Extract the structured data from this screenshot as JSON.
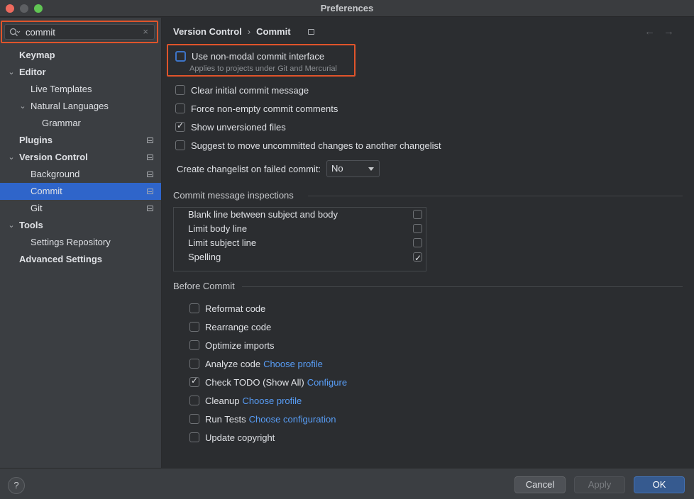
{
  "window": {
    "title": "Preferences"
  },
  "search": {
    "value": "commit",
    "clear_glyph": "×"
  },
  "sidebar": {
    "items": [
      {
        "label": "Keymap"
      },
      {
        "label": "Editor"
      },
      {
        "label": "Live Templates"
      },
      {
        "label": "Natural Languages"
      },
      {
        "label": "Grammar"
      },
      {
        "label": "Plugins"
      },
      {
        "label": "Version Control"
      },
      {
        "label": "Background"
      },
      {
        "label": "Commit"
      },
      {
        "label": "Git"
      },
      {
        "label": "Tools"
      },
      {
        "label": "Settings Repository"
      },
      {
        "label": "Advanced Settings"
      }
    ]
  },
  "breadcrumb": {
    "parent": "Version Control",
    "separator": "›",
    "current": "Commit"
  },
  "nav": {
    "back": "←",
    "forward": "→"
  },
  "options": {
    "non_modal": {
      "label": "Use non-modal commit interface",
      "hint": "Applies to projects under Git and Mercurial",
      "checked": false
    },
    "clear_initial": {
      "label": "Clear initial commit message",
      "checked": false
    },
    "force_nonempty": {
      "label": "Force non-empty commit comments",
      "checked": false
    },
    "show_unversioned": {
      "label": "Show unversioned files",
      "checked": true
    },
    "suggest_move": {
      "label": "Suggest to move uncommitted changes to another changelist",
      "checked": false
    }
  },
  "changelist": {
    "label": "Create changelist on failed commit:",
    "value": "No"
  },
  "inspections": {
    "title": "Commit message inspections",
    "items": [
      {
        "label": "Blank line between subject and body",
        "checked": false
      },
      {
        "label": "Limit body line",
        "checked": false
      },
      {
        "label": "Limit subject line",
        "checked": false
      },
      {
        "label": "Spelling",
        "checked": true
      }
    ]
  },
  "before_commit": {
    "title": "Before Commit",
    "items": [
      {
        "label": "Reformat code",
        "link": "",
        "checked": false
      },
      {
        "label": "Rearrange code",
        "link": "",
        "checked": false
      },
      {
        "label": "Optimize imports",
        "link": "",
        "checked": false
      },
      {
        "label": "Analyze code",
        "link": "Choose profile",
        "checked": false
      },
      {
        "label": "Check TODO (Show All)",
        "link": "Configure",
        "checked": true
      },
      {
        "label": "Cleanup",
        "link": "Choose profile",
        "checked": false
      },
      {
        "label": "Run Tests",
        "link": "Choose configuration",
        "checked": false
      },
      {
        "label": "Update copyright",
        "link": "",
        "checked": false
      }
    ]
  },
  "footer": {
    "help": "?",
    "cancel": "Cancel",
    "apply": "Apply",
    "ok": "OK"
  },
  "colors": {
    "accent": "#2f65ca",
    "highlight": "#e0542b",
    "link": "#589df6"
  }
}
